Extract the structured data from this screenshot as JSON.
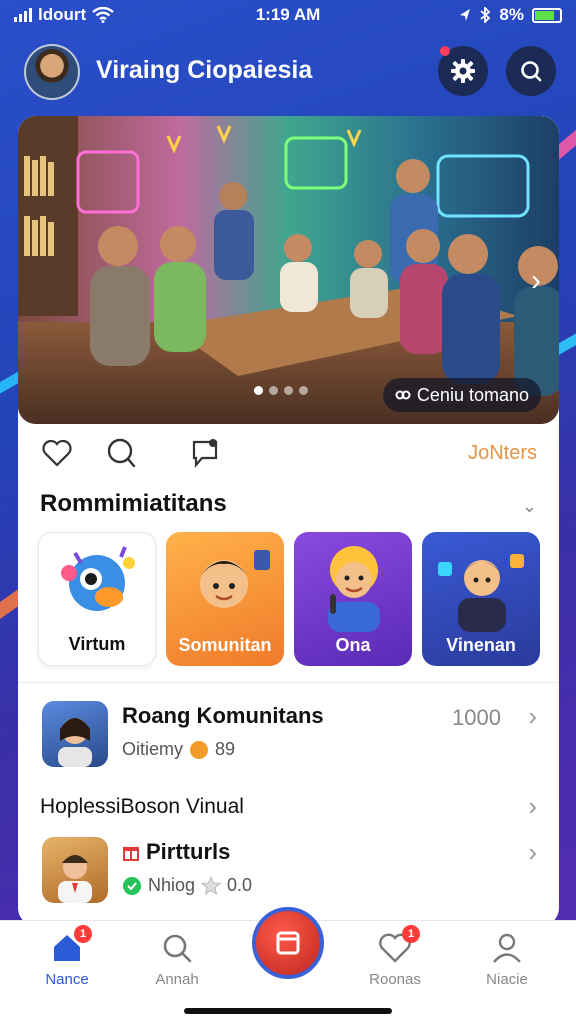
{
  "status": {
    "carrier": "ldourt",
    "time": "1:19 AM",
    "battery": "8%"
  },
  "header": {
    "title": "Viraing Ciopaiesia"
  },
  "hero": {
    "chip_label": "Ceniu tomano"
  },
  "actions": {
    "link_label": "JoNters"
  },
  "section": {
    "title": "Rommimiatitans",
    "tiles": [
      {
        "label": "Virtum"
      },
      {
        "label": "Somunitan"
      },
      {
        "label": "Ona"
      },
      {
        "label": "Vinenan"
      }
    ]
  },
  "list": {
    "rows": [
      {
        "title": "Roang Komunitans",
        "sub_text": "Oitiemy",
        "sub_count": "89",
        "count": "1000"
      },
      {
        "heading": "HoplessiBoson Vinual"
      },
      {
        "title": "Pirtturls",
        "sub_text": "Nhiog",
        "sub_count": "0.0"
      }
    ]
  },
  "tabbar": {
    "tabs": [
      {
        "label": "Nance",
        "badge": "1"
      },
      {
        "label": "Annah"
      },
      {
        "label": "Roonas",
        "badge": "1"
      },
      {
        "label": "Niacie"
      }
    ]
  },
  "colors": {
    "accent": "#2a5bd7",
    "link": "#e39445",
    "fab": "#d83a2f"
  }
}
